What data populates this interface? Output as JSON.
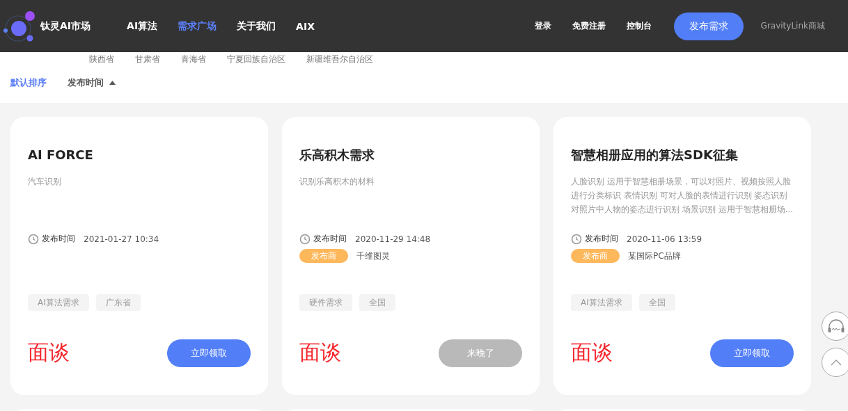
{
  "brand": "钛灵AI市场",
  "nav": [
    {
      "label": "AI算法",
      "selected": false
    },
    {
      "label": "需求广场",
      "selected": true
    },
    {
      "label": "关于我们",
      "selected": false
    },
    {
      "label": "AIX",
      "selected": false
    }
  ],
  "account_links": [
    "登录",
    "免费注册",
    "控制台"
  ],
  "publish_button": "发布需求",
  "store_link": "GravityLink商城",
  "regions": [
    "陕西省",
    "甘肃省",
    "青海省",
    "宁夏回族自治区",
    "新疆维吾尔自治区"
  ],
  "sort_options": [
    {
      "label": "默认排序",
      "selected": true,
      "caret": false
    },
    {
      "label": "发布时间",
      "selected": false,
      "caret": true
    }
  ],
  "cards": [
    {
      "title": "AI FORCE",
      "description": "汽车识别",
      "time_label": "发布时间",
      "time": "2021-01-27 10:34",
      "tags": [
        "AI算法需求",
        "广东省"
      ],
      "price": "面谈",
      "action": "立即领取",
      "disabled": false
    },
    {
      "title": "乐高积木需求",
      "description": "识别乐高积木的材料",
      "time_label": "发布时间",
      "time": "2020-11-29 14:48",
      "publisher_label": "发布商",
      "publisher": "千维图灵",
      "tags": [
        "硬件需求",
        "全国"
      ],
      "price": "面谈",
      "action": "来晚了",
      "disabled": true
    },
    {
      "title": "智慧相册应用的算法SDK征集",
      "description": "人脸识别 运用于智慧相册场景，可以对照片、视频按照人脸进行分类标识 表情识别 可对人脸的表情进行识别 姿态识别对照片中人物的姿态进行识别 场景识别 运用于智慧相册场...",
      "time_label": "发布时间",
      "time": "2020-11-06 13:59",
      "publisher_label": "发布商",
      "publisher": "某国际PC品牌",
      "tags": [
        "AI算法需求",
        "全国"
      ],
      "price": "面谈",
      "action": "立即领取",
      "disabled": false
    }
  ]
}
